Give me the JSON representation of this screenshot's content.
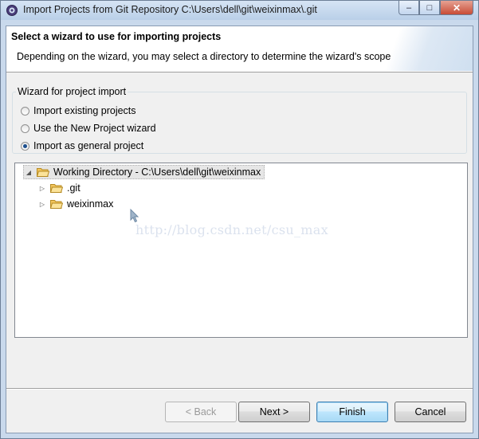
{
  "window": {
    "title": "Import Projects from Git Repository C:\\Users\\dell\\git\\weixinmax\\.git",
    "icon": "eclipse-gear-icon"
  },
  "header": {
    "title": "Select a wizard to use for importing projects",
    "description": "Depending on the wizard, you may select a directory to determine the wizard's scope"
  },
  "wizard_group": {
    "legend": "Wizard for project import",
    "options": [
      {
        "label": "Import existing projects",
        "checked": false
      },
      {
        "label": "Use the New Project wizard",
        "checked": false
      },
      {
        "label": "Import as general project",
        "checked": true
      }
    ]
  },
  "tree": {
    "root": {
      "label": "Working Directory - C:\\Users\\dell\\git\\weixinmax",
      "expanded": true,
      "selected": true
    },
    "children": [
      {
        "label": ".git",
        "expanded": false
      },
      {
        "label": "weixinmax",
        "expanded": false
      }
    ]
  },
  "watermark": "http://blog.csdn.net/csu_max",
  "buttons": {
    "back": "< Back",
    "next": "Next >",
    "finish": "Finish",
    "cancel": "Cancel"
  },
  "colors": {
    "radio_check": "#1d4f8e",
    "default_button_border": "#3c7fb1",
    "folder_fill": "#f2c55c"
  }
}
